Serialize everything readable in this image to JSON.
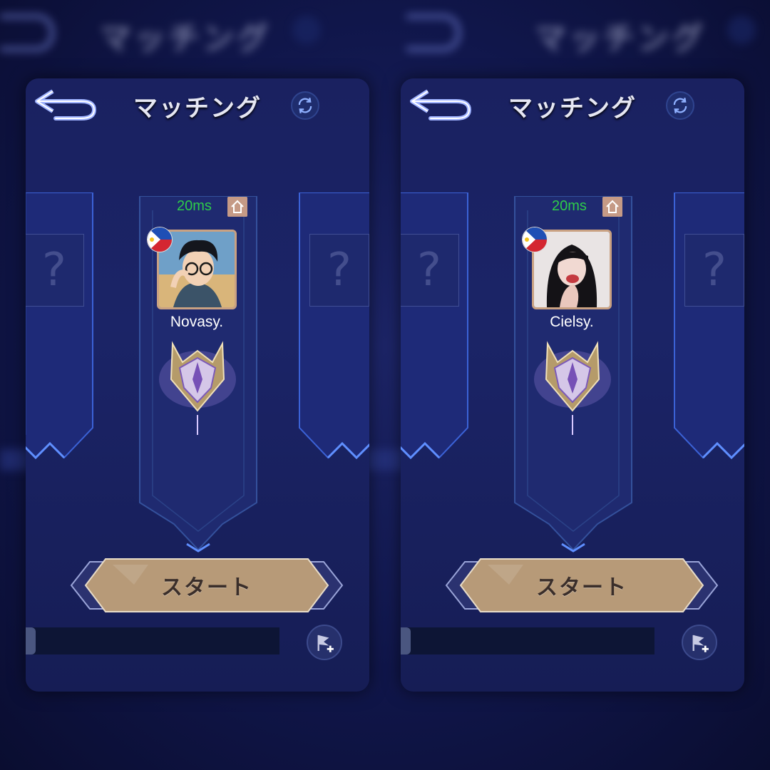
{
  "backdrop": {
    "title": "マッチング"
  },
  "panels": [
    {
      "title": "マッチング",
      "ping": "20ms",
      "player_name": "Novasy.",
      "start_label": "スタート",
      "empty_slot_left": "?",
      "empty_slot_right": "?",
      "country": "philippines-flag-icon"
    },
    {
      "title": "マッチング",
      "ping": "20ms",
      "player_name": "Cielsy.",
      "start_label": "スタート",
      "empty_slot_left": "?",
      "empty_slot_right": "?",
      "country": "philippines-flag-icon"
    }
  ],
  "colors": {
    "ping": "#2ecc4a",
    "panel_bg": "#1b2467",
    "accent_blue": "#5f8fff",
    "start_button": "#b79a78"
  }
}
